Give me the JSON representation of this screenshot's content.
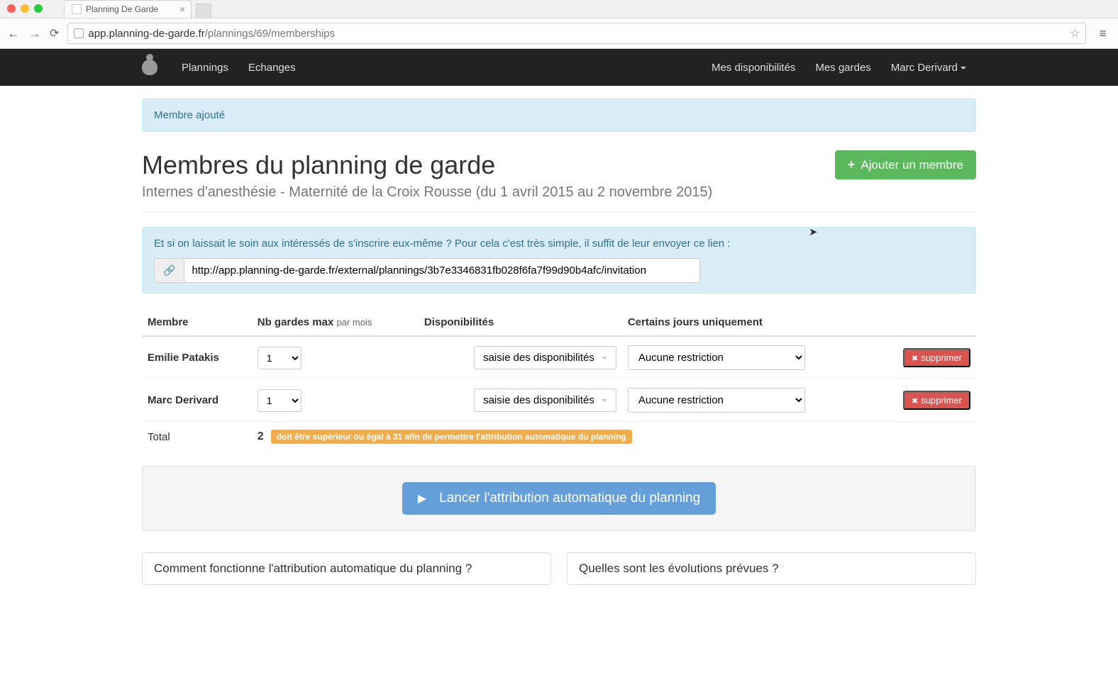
{
  "browser": {
    "tab_title": "Planning De Garde",
    "url_host": "app.planning-de-garde.fr",
    "url_path": "/plannings/69/memberships"
  },
  "nav": {
    "link1": "Plannings",
    "link2": "Echanges",
    "link3": "Mes disponibilités",
    "link4": "Mes gardes",
    "user": "Marc Derivard"
  },
  "flash": {
    "msg": "Membre ajouté"
  },
  "header": {
    "title": "Membres du planning de garde",
    "subtitle": "Internes d'anesthésie - Maternité de la Croix Rousse (du 1 avril 2015 au 2 novembre 2015)",
    "add_btn": "Ajouter un membre"
  },
  "invite": {
    "text": "Et si on laissait le soin aux intéressés de s'inscrire eux-même ? Pour cela c'est très simple, il suffit de leur envoyer ce lien :",
    "url": "http://app.planning-de-garde.fr/external/plannings/3b7e3346831fb028f6fa7f99d90b4afc/invitation"
  },
  "table": {
    "cols": {
      "member": "Membre",
      "nbmax_a": "Nb gardes max",
      "nbmax_b": "par mois",
      "disp": "Disponibilités",
      "days": "Certains jours uniquement"
    },
    "disp_btn": "saisie des disponibilités",
    "restriction": "Aucune restriction",
    "delete": "supprimer",
    "rows": [
      {
        "name": "Emilie Patakis",
        "nb": "1"
      },
      {
        "name": "Marc Derivard",
        "nb": "1"
      }
    ],
    "total_label": "Total",
    "total_value": "2",
    "total_warning": "doit être supérieur ou égal à 31 afin de permettre l'attribution automatique du planning"
  },
  "launch": {
    "btn": "Lancer l'attribution automatique du planning"
  },
  "faq": {
    "q1": "Comment fonctionne l'attribution automatique du planning ?",
    "q2": "Quelles sont les évolutions prévues ?"
  }
}
